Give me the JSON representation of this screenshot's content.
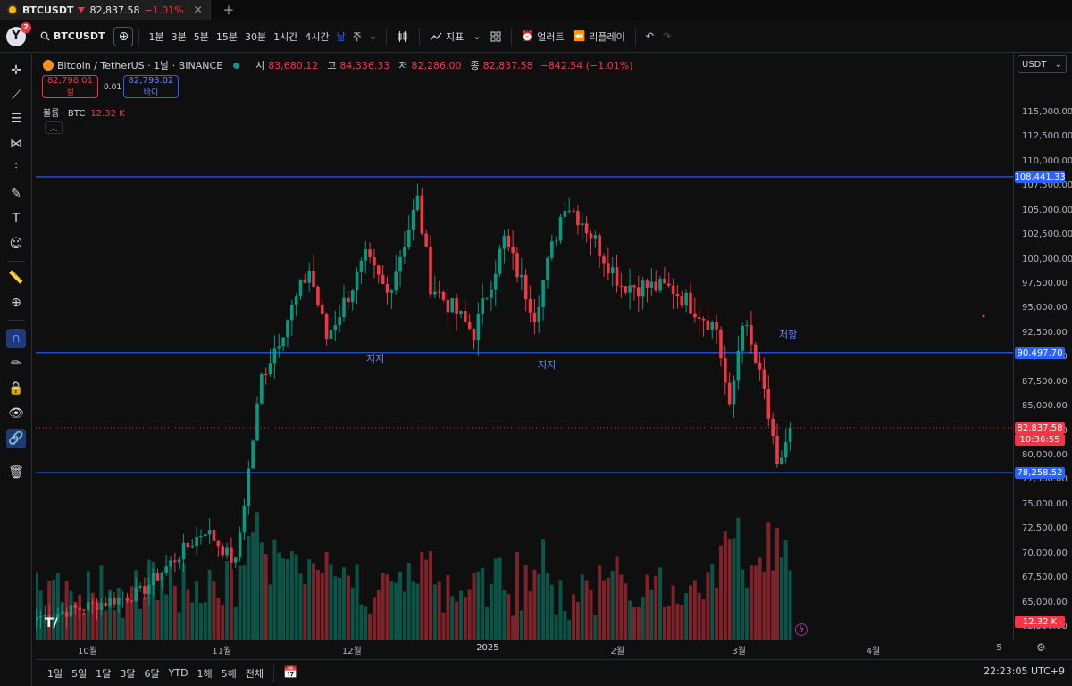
{
  "browser_tab": {
    "symbol": "BTCUSDT",
    "price": "82,837.58",
    "change": "−1.01%"
  },
  "toolbar": {
    "avatar_letter": "Y",
    "notification_count": "2",
    "symbol": "BTCUSDT",
    "timeframes": [
      "1분",
      "3분",
      "5분",
      "15분",
      "30분",
      "1시간",
      "4시간",
      "날",
      "주"
    ],
    "active_timeframe": "날",
    "indicators_label": "지표",
    "alert_label": "얼러트",
    "replay_label": "리플레이"
  },
  "legend": {
    "title": "Bitcoin / TetherUS · 1날 · BINANCE",
    "open_label": "시",
    "open": "83,680.12",
    "high_label": "고",
    "high": "84,336.33",
    "low_label": "저",
    "low": "82,286.00",
    "close_label": "종",
    "close": "82,837.58",
    "change": "−842.54 (−1.01%)"
  },
  "trade": {
    "sell_price": "82,798.01",
    "sell_label": "셀",
    "spread": "0.01",
    "buy_price": "82,798.02",
    "buy_label": "바이"
  },
  "volume_legend": {
    "label": "볼륨 · BTC",
    "value": "12.32 K"
  },
  "currency": "USDT",
  "price_ticks": [
    "115,000.00",
    "112,500.00",
    "110,000.00",
    "107,500.00",
    "105,000.00",
    "102,500.00",
    "100,000.00",
    "97,500.00",
    "95,000.00",
    "92,500.00",
    "90,000.00",
    "87,500.00",
    "85,000.00",
    "82,500.00",
    "80,000.00",
    "77,500.00",
    "75,000.00",
    "72,500.00",
    "70,000.00",
    "67,500.00",
    "65,000.00",
    "62,500.00"
  ],
  "horizontal_lines": [
    {
      "price": 108441.33,
      "label": "108,441.33",
      "color": "#2962ff"
    },
    {
      "price": 90497.7,
      "label": "90,497.70",
      "color": "#2962ff"
    },
    {
      "price": 78258.52,
      "label": "78,258.52",
      "color": "#2962ff"
    }
  ],
  "annotations": [
    {
      "text": "지지",
      "anchor": "first support touch (early Dec)"
    },
    {
      "text": "지지",
      "anchor": "second support touch (early Jan)"
    },
    {
      "text": "저항",
      "anchor": "resistance (mid Mar)"
    }
  ],
  "last_price_tag": {
    "price": "82,837.58",
    "countdown": "10:36:55"
  },
  "volume_tag": "12.32 K",
  "time_labels": [
    "10월",
    "11월",
    "12월",
    "2025",
    "2월",
    "3월",
    "4월",
    "5"
  ],
  "range_buttons": [
    "1일",
    "5일",
    "1달",
    "3달",
    "6달",
    "YTD",
    "1해",
    "5해",
    "전체"
  ],
  "clock": "22:23:05 UTC+9",
  "colors": {
    "up": "#089981",
    "down": "#f23645",
    "line": "#2962ff",
    "bg": "#0f0f0f"
  },
  "chart_data": {
    "type": "candlestick",
    "symbol": "BTCUSDT",
    "interval": "1D",
    "ylim": [
      61500,
      117000
    ],
    "anchors": [
      {
        "date": "2024-09-20",
        "close": 63500
      },
      {
        "date": "2024-10-01",
        "close": 64500
      },
      {
        "date": "2024-10-14",
        "close": 66000
      },
      {
        "date": "2024-10-29",
        "close": 72500
      },
      {
        "date": "2024-11-05",
        "close": 69000
      },
      {
        "date": "2024-11-11",
        "close": 88000
      },
      {
        "date": "2024-11-22",
        "close": 99000
      },
      {
        "date": "2024-11-26",
        "close": 92000
      },
      {
        "date": "2024-12-05",
        "close": 100000
      },
      {
        "date": "2024-12-10",
        "close": 96500
      },
      {
        "date": "2024-12-17",
        "close": 106000
      },
      {
        "date": "2024-12-20",
        "close": 97500
      },
      {
        "date": "2024-12-30",
        "close": 92500
      },
      {
        "date": "2025-01-06",
        "close": 102000
      },
      {
        "date": "2025-01-13",
        "close": 94500
      },
      {
        "date": "2025-01-20",
        "close": 106000
      },
      {
        "date": "2025-01-24",
        "close": 104000
      },
      {
        "date": "2025-02-02",
        "close": 97500
      },
      {
        "date": "2025-02-14",
        "close": 97000
      },
      {
        "date": "2025-02-24",
        "close": 93000
      },
      {
        "date": "2025-02-27",
        "close": 84500
      },
      {
        "date": "2025-03-02",
        "close": 94000
      },
      {
        "date": "2025-03-07",
        "close": 86500
      },
      {
        "date": "2025-03-10",
        "close": 78500
      },
      {
        "date": "2025-03-13",
        "close": 82800
      }
    ],
    "last_close": 82837.58,
    "last_volume": "12.32 K"
  }
}
